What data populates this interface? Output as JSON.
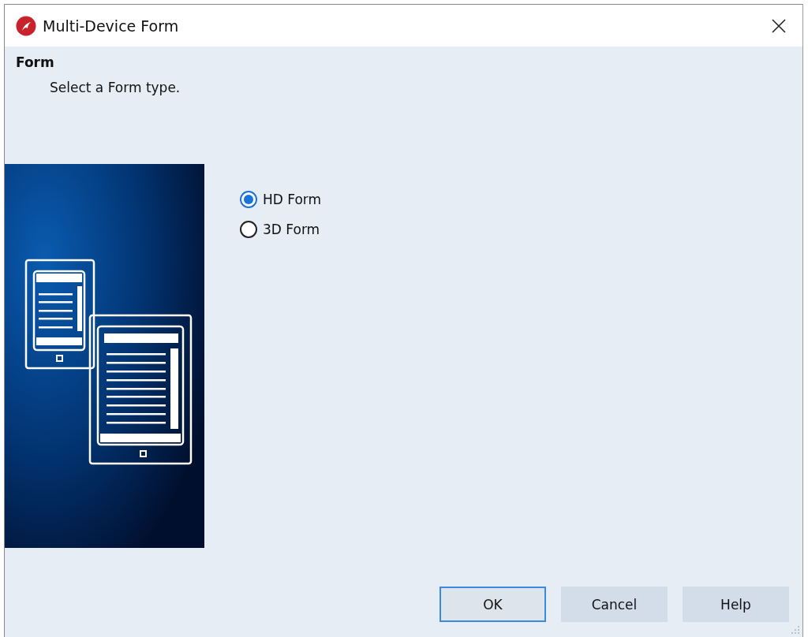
{
  "window": {
    "title": "Multi-Device Form"
  },
  "header": {
    "title": "Form",
    "subtitle": "Select a Form type."
  },
  "options": [
    {
      "label": "HD Form",
      "selected": true
    },
    {
      "label": "3D Form",
      "selected": false
    }
  ],
  "buttons": [
    {
      "label": "OK",
      "default": true
    },
    {
      "label": "Cancel",
      "default": false
    },
    {
      "label": "Help",
      "default": false
    }
  ]
}
